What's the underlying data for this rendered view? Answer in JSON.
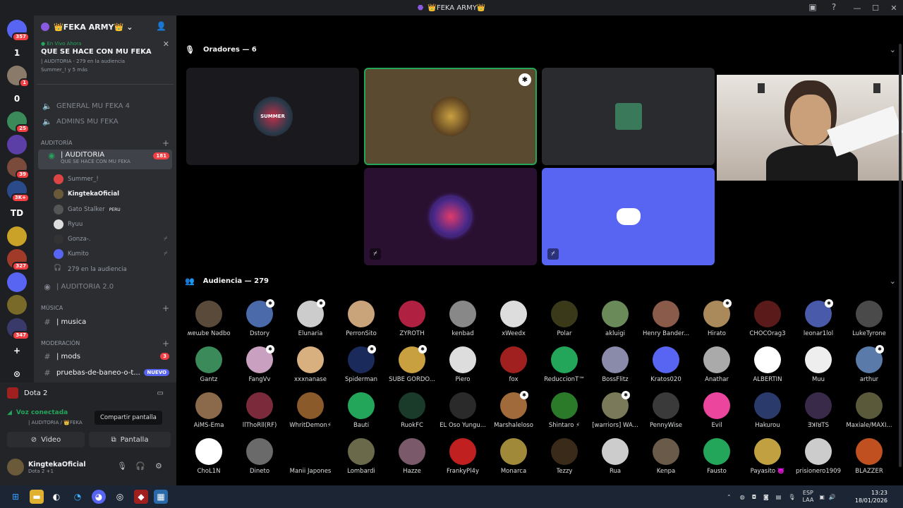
{
  "window": {
    "title": "👑FEKA ARMY👑",
    "controls": [
      "—",
      "☐",
      "✕"
    ]
  },
  "servers": [
    {
      "label": "",
      "badge": "357",
      "color": "#5865f2"
    },
    {
      "label": "1",
      "badge": "",
      "color": ""
    },
    {
      "label": "",
      "badge": "1",
      "color": "#8a7a6a"
    },
    {
      "label": "0",
      "badge": "",
      "color": ""
    },
    {
      "label": "",
      "badge": "25",
      "color": "#3a8a5a"
    },
    {
      "label": "",
      "badge": "",
      "color": "#5b3fa6"
    },
    {
      "label": "",
      "badge": "39",
      "color": "#7a4a3a"
    },
    {
      "label": "",
      "badge": "3K+",
      "color": "#2a4a8a"
    },
    {
      "label": "TD",
      "badge": "",
      "color": ""
    },
    {
      "label": "",
      "badge": "",
      "color": "#c9a227"
    },
    {
      "label": "",
      "badge": "327",
      "color": "#a23a2a"
    },
    {
      "label": "",
      "badge": "",
      "color": "#5865f2"
    },
    {
      "label": "",
      "badge": "",
      "color": "#7a6a2a"
    },
    {
      "label": "",
      "badge": "347",
      "color": "#3a3a6a"
    },
    {
      "label": "+",
      "badge": "",
      "color": ""
    },
    {
      "label": "⊙",
      "badge": "",
      "color": ""
    }
  ],
  "guild": {
    "name": "👑FEKA ARMY👑",
    "live": {
      "tag": "En Vivo Ahora",
      "title": "QUE SE HACE CON MU FEKA",
      "meta": "| AUDITORIA · 279 en la audiencia",
      "people": "Summer_! y 5 más"
    },
    "channels": {
      "general": "GENERAL MU FEKA 4",
      "admins": "ADMINS MU FEKA",
      "cat_auditoria": "AUDITORÍA",
      "auditoria": "| AUDITORIA",
      "auditoria_badge": "181",
      "auditoria_topic": "QUE SE HACE CON MU FEKA",
      "auditoria2": "| AUDITORIA 2.0",
      "cat_musica": "MÚSICA",
      "musica": "| musica",
      "cat_moderacion": "MODERACIÓN",
      "mods": "| mods",
      "mods_badge": "3",
      "pruebas": "pruebas-de-baneo-o-t...",
      "pruebas_badge": "NUEVO"
    },
    "members": [
      {
        "name": "Summer_!",
        "color": "#d44"
      },
      {
        "name": "KingtekaOficial",
        "color": "#6b5a3a"
      },
      {
        "name": "Gato Stalker",
        "tag": "PERU",
        "color": "#555"
      },
      {
        "name": "Ryuu",
        "color": "#ddd"
      },
      {
        "name": "Gonza-.",
        "color": "#333"
      },
      {
        "name": "Kumito",
        "color": "#5865f2"
      },
      {
        "name": "279 en la audiencia",
        "color": ""
      }
    ]
  },
  "panel": {
    "activity": "Dota 2",
    "voice_status": "Voz conectada",
    "voice_sub": "| AUDITORIA / 👑FEKA",
    "tooltip": "Compartir pantalla",
    "video_btn": "Video",
    "screen_btn": "Pantalla",
    "user_name": "KingtekaOficial",
    "user_sub": "Dota 2 +1"
  },
  "stage": {
    "speakers_label": "Oradores — 6",
    "audience_label": "Audiencia — 279",
    "tiles": [
      {
        "label": "SUMMER",
        "bg": "#1a1a1e",
        "av": "#2a3a4a"
      },
      {
        "label": "",
        "bg": "#5a4a30",
        "av": "#8a6a2a"
      },
      {
        "label": "",
        "bg": "#2a2b2f",
        "av": "#3a7a5a"
      },
      {
        "label": "",
        "bg": "#2a1030",
        "av": "#4a2a8a"
      },
      {
        "label": "",
        "bg": "#5865f2",
        "av": "#5865f2"
      }
    ]
  },
  "audience": [
    {
      "name": "ʍɐɯbɐ Nǝdbo",
      "c": "#5a4a3a"
    },
    {
      "name": "Dstory",
      "c": "#4a6aaa",
      "b": true
    },
    {
      "name": "Elunaria",
      "c": "#ccc",
      "b": true
    },
    {
      "name": "PerronSito",
      "c": "#c9a37a"
    },
    {
      "name": "ZYROTH",
      "c": "#b02040"
    },
    {
      "name": "kenbad",
      "c": "#888"
    },
    {
      "name": "xWeedx",
      "c": "#ddd"
    },
    {
      "name": "Polar",
      "c": "#3a3a1a"
    },
    {
      "name": "akluigi",
      "c": "#6a8a5a"
    },
    {
      "name": "Henry Bander...",
      "c": "#8a5a4a"
    },
    {
      "name": "Hirato",
      "c": "#aa8a5a",
      "b": true
    },
    {
      "name": "CHOCOrag3",
      "c": "#5a1a1a"
    },
    {
      "name": "leonar1lol",
      "c": "#4a5aaa",
      "b": true
    },
    {
      "name": "LukeTyrone",
      "c": "#4a4a4a"
    },
    {
      "name": "Gantz",
      "c": "#3a8a5a"
    },
    {
      "name": "FangVv",
      "c": "#c9a0c0",
      "b": true
    },
    {
      "name": "xxxnanase",
      "c": "#d8b080"
    },
    {
      "name": "Spiderman",
      "c": "#1a2a5a",
      "b": true
    },
    {
      "name": "SUBE GORDO...",
      "c": "#c9a040",
      "b": true
    },
    {
      "name": "Piero",
      "c": "#ddd"
    },
    {
      "name": "fox",
      "c": "#a02020"
    },
    {
      "name": "ReduccionT™",
      "c": "#23a55a"
    },
    {
      "name": "BossFlitz",
      "c": "#8a8aaa"
    },
    {
      "name": "Kratos020",
      "c": "#5865f2"
    },
    {
      "name": "Anathar",
      "c": "#aaa"
    },
    {
      "name": "ALBERTIN",
      "c": "#fff"
    },
    {
      "name": "Muu",
      "c": "#eee"
    },
    {
      "name": "arthur",
      "c": "#5a7aaa",
      "b": true
    },
    {
      "name": "AiMS-Ema",
      "c": "#8a6a4a"
    },
    {
      "name": "llThoRll(RF)",
      "c": "#7a2a3a"
    },
    {
      "name": "WhritDemon⚡",
      "c": "#8a5a2a"
    },
    {
      "name": "Bauti",
      "c": "#23a55a"
    },
    {
      "name": "RuokFC",
      "c": "#1a3a2a"
    },
    {
      "name": "EL Oso Yungu...",
      "c": "#2a2a2a"
    },
    {
      "name": "Marshaleloso",
      "c": "#a06a3a",
      "b": true
    },
    {
      "name": "Shintaro ⚡",
      "c": "#2a7a2a"
    },
    {
      "name": "[warriors] WA...",
      "c": "#7a7a5a",
      "b": true
    },
    {
      "name": "PennyWise",
      "c": "#3a3a3a"
    },
    {
      "name": "Evil",
      "c": "#eb459e"
    },
    {
      "name": "Hakurou",
      "c": "#2a3a6a"
    },
    {
      "name": "ƎꓘIꓤTS",
      "c": "#3a2a4a"
    },
    {
      "name": "Maxiale/MAXI...",
      "c": "#5a5a3a"
    },
    {
      "name": "ChoL1N",
      "c": "#fff"
    },
    {
      "name": "Dineto",
      "c": "#6a6a6a"
    },
    {
      "name": "Manii Japones",
      "c": "#000"
    },
    {
      "name": "Lombardi",
      "c": "#6a6a4a"
    },
    {
      "name": "Hazze",
      "c": "#7a5a6a"
    },
    {
      "name": "FrankyPl4y",
      "c": "#c02020"
    },
    {
      "name": "Monarca",
      "c": "#a08a3a"
    },
    {
      "name": "Tezzy",
      "c": "#3a2a1a"
    },
    {
      "name": "Rua",
      "c": "#ccc"
    },
    {
      "name": "Kenpa",
      "c": "#6a5a4a"
    },
    {
      "name": "Fausto",
      "c": "#23a55a"
    },
    {
      "name": "Payasito 👿",
      "c": "#c0a040"
    },
    {
      "name": "prisionero1909",
      "c": "#ccc"
    },
    {
      "name": "BLAZZER",
      "c": "#c05020"
    }
  ],
  "taskbar": {
    "lang1": "ESP",
    "lang2": "LAA",
    "time": "13:23",
    "date": "18/01/2026"
  }
}
